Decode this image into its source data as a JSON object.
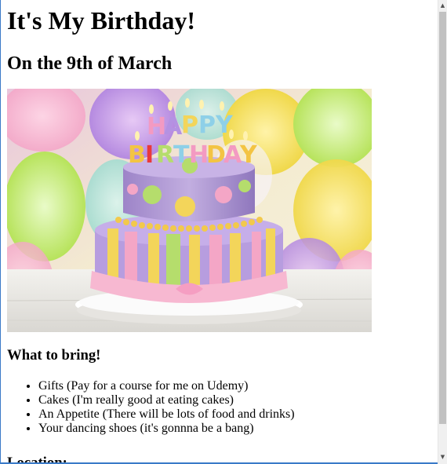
{
  "page": {
    "title": "It's My Birthday!",
    "subtitle": "On the 9th of March",
    "cake_image_alt": "HAPPY BIRTHDAY",
    "bring_heading": "What to bring!",
    "bring_items": [
      "Gifts (Pay for a course for me on Udemy)",
      "Cakes (I'm really good at eating cakes)",
      "An Appetite (There will be lots of food and drinks)",
      "Your dancing shoes (it's gonnna be a bang)"
    ],
    "location_heading": "Location:"
  },
  "scrollbar": {
    "up_arrow": "▲",
    "down_arrow": "▼"
  },
  "colors": {
    "accent_border": "#3a7ac8",
    "scroll_track": "#f0f0f0",
    "scroll_thumb": "#c1c1c1"
  }
}
